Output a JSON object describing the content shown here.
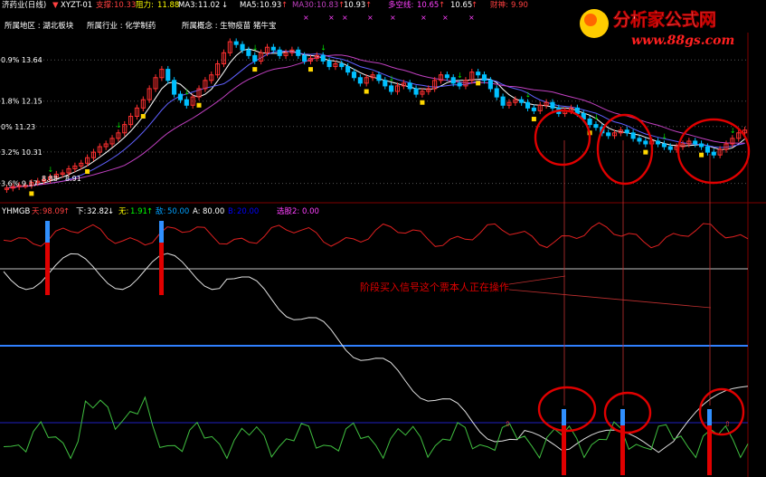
{
  "colors": {
    "background": "#000000",
    "bull": "#ff3030",
    "bear": "#00c0ff",
    "up_arrow": "#00e000",
    "down_arrow": "#ff3030",
    "yellow": "#ffd700",
    "ma_white": "#ffffff",
    "ma_blue": "#6060ff",
    "ma_magenta": "#c040c0",
    "grid": "#555555",
    "annotation": "#e00000"
  },
  "header": {
    "stock_title": "济药业(日线)",
    "indicator": "XYZT-01",
    "support_label": "支撑:",
    "support_value": "10.33",
    "resist_label": "阻力:",
    "resist_value": "11.88",
    "ma3_label": "MA3:",
    "ma3_value": "11.02",
    "ma5_label": "MA5:",
    "ma5_value": "10.93",
    "ma30_label": "MA30:",
    "ma30_value": "10.83",
    "value3": "10.93",
    "duokong_label": "多空线:",
    "duokong_value": "10.65",
    "value5": "10.65",
    "caishen_label": "财神:",
    "caishen_value": "9.90",
    "region": "所属地区 : 湖北板块",
    "industry": "所属行业 : 化学制药",
    "concept": "所属概念 : 生物疫苗  猪牛宝"
  },
  "watermark": {
    "title": "分析家公式网",
    "url": "www.88gs.com"
  },
  "price_levels": [
    {
      "label": "0.9% 13.64",
      "price": 13.64
    },
    {
      "label": "1.8% 12.15",
      "price": 12.15
    },
    {
      "label": "0% 11.23",
      "price": 11.23
    },
    {
      "label": "3.2% 10.31",
      "price": 10.31
    },
    {
      "label": "3.6% 9.17",
      "price": 9.17
    }
  ],
  "low_marker": "8.88",
  "low_marker2": "8.91",
  "sub1": {
    "name": "YHMGB",
    "tian_label": "天:",
    "tian_value": "98.09",
    "xia_label": "下:",
    "xia_value": "32.82",
    "wu_label": "无:",
    "wu_value": "1.91",
    "di_label": "敌:",
    "di_value": "50.00",
    "a_label": "A:",
    "a_value": "80.00",
    "b_label": "B:",
    "b_value": "20.00",
    "xuangu_label": "选股2:",
    "xuangu_value": "0.00"
  },
  "annotation": "阶段买入信号这个票本人正在操作",
  "chart_data": {
    "type": "candlestick",
    "price_range": [
      8.6,
      14.5
    ],
    "candles_open": [
      8.95,
      9.0,
      9.05,
      9.1,
      9.1,
      9.2,
      9.25,
      9.3,
      9.4,
      9.5,
      9.55,
      9.7,
      9.8,
      9.9,
      10.1,
      10.3,
      10.5,
      10.6,
      10.8,
      11.0,
      11.3,
      11.6,
      11.9,
      12.2,
      12.6,
      13.0,
      13.3,
      12.9,
      12.4,
      12.2,
      12.0,
      12.3,
      12.6,
      12.9,
      13.1,
      13.5,
      13.9,
      14.3,
      14.2,
      14.0,
      13.8,
      13.6,
      13.9,
      14.1,
      14.0,
      13.8,
      13.9,
      14.0,
      13.8,
      13.6,
      13.7,
      13.8,
      13.6,
      13.4,
      13.5,
      13.4,
      13.2,
      13.0,
      12.8,
      13.0,
      13.1,
      12.9,
      12.7,
      12.5,
      12.7,
      12.8,
      12.6,
      12.4,
      12.5,
      12.6,
      12.9,
      13.1,
      13.0,
      12.8,
      12.7,
      12.9,
      13.2,
      13.1,
      12.9,
      12.6,
      12.3,
      12.0,
      12.1,
      12.2,
      12.1,
      11.9,
      11.8,
      12.0,
      12.1,
      11.9,
      11.7,
      11.8,
      11.9,
      11.7,
      11.5,
      11.3,
      11.2,
      11.0,
      10.9,
      11.0,
      11.1,
      11.0,
      10.8,
      10.7,
      10.6,
      10.7,
      10.6,
      10.5,
      10.4,
      10.5,
      10.6,
      10.7,
      10.6,
      10.5,
      10.3,
      10.2,
      10.4,
      10.6,
      10.8,
      11.0
    ],
    "candles_close": [
      9.0,
      9.05,
      9.1,
      9.1,
      9.2,
      9.25,
      9.3,
      9.4,
      9.5,
      9.55,
      9.7,
      9.8,
      9.9,
      10.1,
      10.3,
      10.5,
      10.6,
      10.8,
      11.0,
      11.3,
      11.6,
      11.9,
      12.2,
      12.6,
      13.0,
      13.3,
      12.9,
      12.4,
      12.2,
      12.0,
      12.3,
      12.6,
      12.9,
      13.1,
      13.5,
      13.9,
      14.3,
      14.2,
      14.0,
      13.8,
      13.6,
      13.9,
      14.1,
      14.0,
      13.8,
      13.9,
      14.0,
      13.8,
      13.6,
      13.7,
      13.8,
      13.6,
      13.4,
      13.5,
      13.4,
      13.2,
      13.0,
      12.8,
      13.0,
      13.1,
      12.9,
      12.7,
      12.5,
      12.7,
      12.8,
      12.6,
      12.4,
      12.5,
      12.6,
      12.9,
      13.1,
      13.0,
      12.8,
      12.7,
      12.9,
      13.2,
      13.1,
      12.9,
      12.6,
      12.3,
      12.0,
      12.1,
      12.2,
      12.1,
      11.9,
      11.8,
      12.0,
      12.1,
      11.9,
      11.7,
      11.8,
      11.9,
      11.7,
      11.5,
      11.3,
      11.2,
      11.0,
      10.9,
      11.0,
      11.1,
      11.0,
      10.8,
      10.7,
      10.6,
      10.7,
      10.6,
      10.5,
      10.4,
      10.5,
      10.6,
      10.7,
      10.6,
      10.5,
      10.3,
      10.2,
      10.4,
      10.6,
      10.8,
      11.0,
      11.1
    ]
  }
}
